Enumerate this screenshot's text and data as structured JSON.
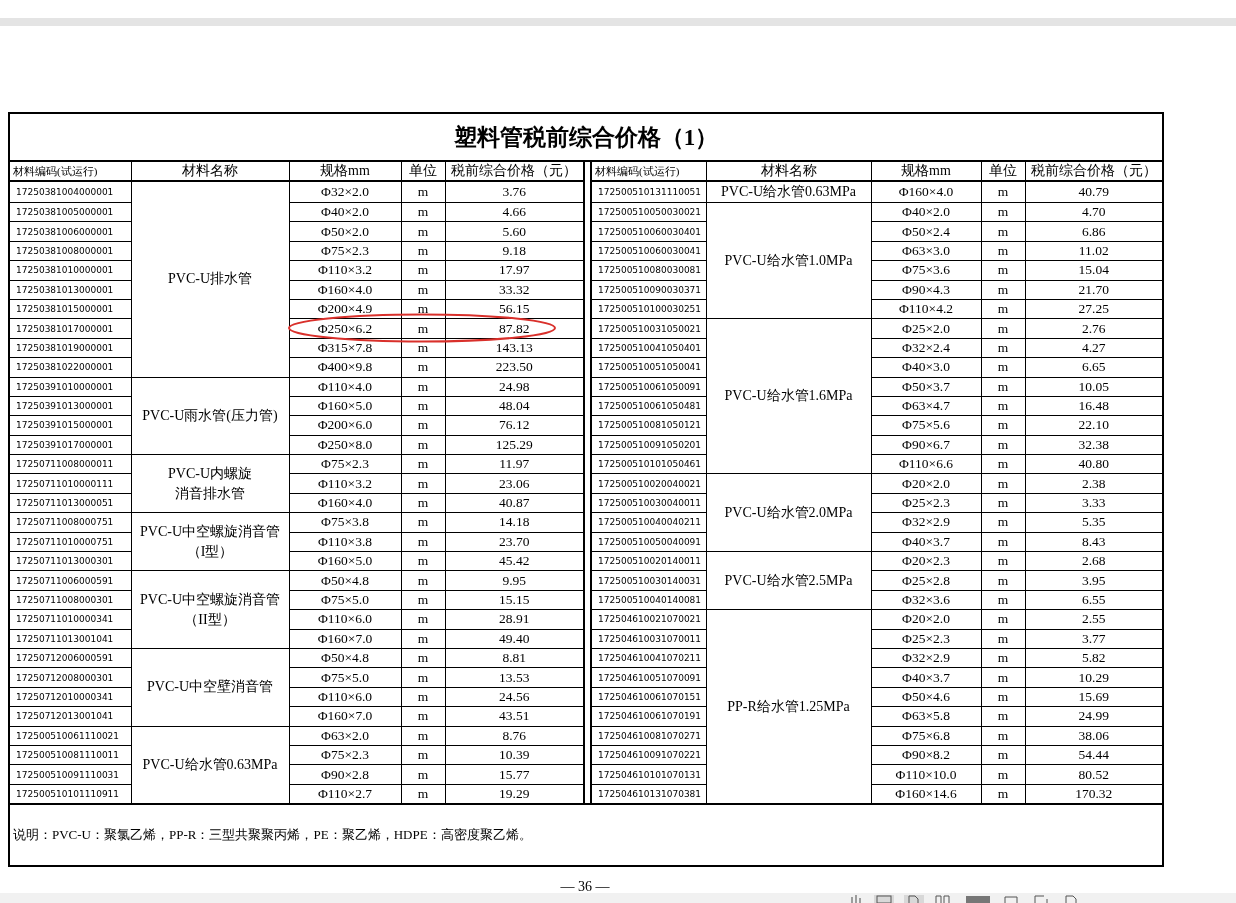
{
  "title": "塑料管税前综合价格（1）",
  "left": {
    "columns": [
      "材料编码(试运行)",
      "材料名称",
      "规格mm",
      "单位",
      "税前综合价格（元）"
    ],
    "groups": [
      {
        "name_lines": [
          "PVC-U排水管"
        ],
        "rows": [
          {
            "code": "17250381004000001",
            "spec": "Φ32×2.0",
            "unit": "m",
            "price": "3.76",
            "circled": false
          },
          {
            "code": "17250381005000001",
            "spec": "Φ40×2.0",
            "unit": "m",
            "price": "4.66",
            "circled": false
          },
          {
            "code": "17250381006000001",
            "spec": "Φ50×2.0",
            "unit": "m",
            "price": "5.60",
            "circled": false
          },
          {
            "code": "17250381008000001",
            "spec": "Φ75×2.3",
            "unit": "m",
            "price": "9.18",
            "circled": false
          },
          {
            "code": "17250381010000001",
            "spec": "Φ110×3.2",
            "unit": "m",
            "price": "17.97",
            "circled": false
          },
          {
            "code": "17250381013000001",
            "spec": "Φ160×4.0",
            "unit": "m",
            "price": "33.32",
            "circled": false
          },
          {
            "code": "17250381015000001",
            "spec": "Φ200×4.9",
            "unit": "m",
            "price": "56.15",
            "circled": false
          },
          {
            "code": "17250381017000001",
            "spec": "Φ250×6.2",
            "unit": "m",
            "price": "87.82",
            "circled": true
          },
          {
            "code": "17250381019000001",
            "spec": "Φ315×7.8",
            "unit": "m",
            "price": "143.13",
            "circled": false
          },
          {
            "code": "17250381022000001",
            "spec": "Φ400×9.8",
            "unit": "m",
            "price": "223.50",
            "circled": false
          }
        ]
      },
      {
        "name_lines": [
          "PVC-U雨水管(压力管)"
        ],
        "rows": [
          {
            "code": "17250391010000001",
            "spec": "Φ110×4.0",
            "unit": "m",
            "price": "24.98",
            "circled": false
          },
          {
            "code": "17250391013000001",
            "spec": "Φ160×5.0",
            "unit": "m",
            "price": "48.04",
            "circled": false
          },
          {
            "code": "17250391015000001",
            "spec": "Φ200×6.0",
            "unit": "m",
            "price": "76.12",
            "circled": false
          },
          {
            "code": "17250391017000001",
            "spec": "Φ250×8.0",
            "unit": "m",
            "price": "125.29",
            "circled": false
          }
        ]
      },
      {
        "name_lines": [
          "PVC-U内螺旋",
          "消音排水管"
        ],
        "rows": [
          {
            "code": "17250711008000011",
            "spec": "Φ75×2.3",
            "unit": "m",
            "price": "11.97",
            "circled": false
          },
          {
            "code": "17250711010000111",
            "spec": "Φ110×3.2",
            "unit": "m",
            "price": "23.06",
            "circled": false
          },
          {
            "code": "17250711013000051",
            "spec": "Φ160×4.0",
            "unit": "m",
            "price": "40.87",
            "circled": false
          }
        ]
      },
      {
        "name_lines": [
          "PVC-U中空螺旋消音管",
          "（I型）"
        ],
        "rows": [
          {
            "code": "17250711008000751",
            "spec": "Φ75×3.8",
            "unit": "m",
            "price": "14.18",
            "circled": false
          },
          {
            "code": "17250711010000751",
            "spec": "Φ110×3.8",
            "unit": "m",
            "price": "23.70",
            "circled": false
          },
          {
            "code": "17250711013000301",
            "spec": "Φ160×5.0",
            "unit": "m",
            "price": "45.42",
            "circled": false
          }
        ]
      },
      {
        "name_lines": [
          "PVC-U中空螺旋消音管",
          "（II型）"
        ],
        "rows": [
          {
            "code": "17250711006000591",
            "spec": "Φ50×4.8",
            "unit": "m",
            "price": "9.95",
            "circled": false
          },
          {
            "code": "17250711008000301",
            "spec": "Φ75×5.0",
            "unit": "m",
            "price": "15.15",
            "circled": false
          },
          {
            "code": "17250711010000341",
            "spec": "Φ110×6.0",
            "unit": "m",
            "price": "28.91",
            "circled": false
          },
          {
            "code": "17250711013001041",
            "spec": "Φ160×7.0",
            "unit": "m",
            "price": "49.40",
            "circled": false
          }
        ]
      },
      {
        "name_lines": [
          "PVC-U中空壁消音管"
        ],
        "rows": [
          {
            "code": "17250712006000591",
            "spec": "Φ50×4.8",
            "unit": "m",
            "price": "8.81",
            "circled": false
          },
          {
            "code": "17250712008000301",
            "spec": "Φ75×5.0",
            "unit": "m",
            "price": "13.53",
            "circled": false
          },
          {
            "code": "17250712010000341",
            "spec": "Φ110×6.0",
            "unit": "m",
            "price": "24.56",
            "circled": false
          },
          {
            "code": "17250712013001041",
            "spec": "Φ160×7.0",
            "unit": "m",
            "price": "43.51",
            "circled": false
          }
        ]
      },
      {
        "name_lines": [
          "PVC-U给水管0.63MPa"
        ],
        "rows": [
          {
            "code": "172500510061110021",
            "spec": "Φ63×2.0",
            "unit": "m",
            "price": "8.76",
            "circled": false
          },
          {
            "code": "172500510081110011",
            "spec": "Φ75×2.3",
            "unit": "m",
            "price": "10.39",
            "circled": false
          },
          {
            "code": "172500510091110031",
            "spec": "Φ90×2.8",
            "unit": "m",
            "price": "15.77",
            "circled": false
          },
          {
            "code": "172500510101110911",
            "spec": "Φ110×2.7",
            "unit": "m",
            "price": "19.29",
            "circled": false
          }
        ]
      }
    ]
  },
  "right": {
    "columns": [
      "材料编码(试运行)",
      "材料名称",
      "规格mm",
      "单位",
      "税前综合价格（元）"
    ],
    "groups": [
      {
        "name_lines": [
          "PVC-U给水管0.63MPa"
        ],
        "rows": [
          {
            "code": "172500510131110051",
            "spec": "Φ160×4.0",
            "unit": "m",
            "price": "40.79",
            "circled": false
          }
        ]
      },
      {
        "name_lines": [
          "PVC-U给水管1.0MPa"
        ],
        "rows": [
          {
            "code": "172500510050030021",
            "spec": "Φ40×2.0",
            "unit": "m",
            "price": "4.70",
            "circled": false
          },
          {
            "code": "172500510060030401",
            "spec": "Φ50×2.4",
            "unit": "m",
            "price": "6.86",
            "circled": false
          },
          {
            "code": "172500510060030041",
            "spec": "Φ63×3.0",
            "unit": "m",
            "price": "11.02",
            "circled": false
          },
          {
            "code": "172500510080030081",
            "spec": "Φ75×3.6",
            "unit": "m",
            "price": "15.04",
            "circled": false
          },
          {
            "code": "172500510090030371",
            "spec": "Φ90×4.3",
            "unit": "m",
            "price": "21.70",
            "circled": false
          },
          {
            "code": "172500510100030251",
            "spec": "Φ110×4.2",
            "unit": "m",
            "price": "27.25",
            "circled": false
          }
        ]
      },
      {
        "name_lines": [
          "PVC-U给水管1.6MPa"
        ],
        "rows": [
          {
            "code": "172500510031050021",
            "spec": "Φ25×2.0",
            "unit": "m",
            "price": "2.76",
            "circled": false
          },
          {
            "code": "172500510041050401",
            "spec": "Φ32×2.4",
            "unit": "m",
            "price": "4.27",
            "circled": false
          },
          {
            "code": "172500510051050041",
            "spec": "Φ40×3.0",
            "unit": "m",
            "price": "6.65",
            "circled": false
          },
          {
            "code": "172500510061050091",
            "spec": "Φ50×3.7",
            "unit": "m",
            "price": "10.05",
            "circled": false
          },
          {
            "code": "172500510061050481",
            "spec": "Φ63×4.7",
            "unit": "m",
            "price": "16.48",
            "circled": false
          },
          {
            "code": "172500510081050121",
            "spec": "Φ75×5.6",
            "unit": "m",
            "price": "22.10",
            "circled": false
          },
          {
            "code": "172500510091050201",
            "spec": "Φ90×6.7",
            "unit": "m",
            "price": "32.38",
            "circled": false
          },
          {
            "code": "172500510101050461",
            "spec": "Φ110×6.6",
            "unit": "m",
            "price": "40.80",
            "circled": false
          }
        ]
      },
      {
        "name_lines": [
          "PVC-U给水管2.0MPa"
        ],
        "rows": [
          {
            "code": "172500510020040021",
            "spec": "Φ20×2.0",
            "unit": "m",
            "price": "2.38",
            "circled": false
          },
          {
            "code": "172500510030040011",
            "spec": "Φ25×2.3",
            "unit": "m",
            "price": "3.33",
            "circled": false
          },
          {
            "code": "172500510040040211",
            "spec": "Φ32×2.9",
            "unit": "m",
            "price": "5.35",
            "circled": false
          },
          {
            "code": "172500510050040091",
            "spec": "Φ40×3.7",
            "unit": "m",
            "price": "8.43",
            "circled": false
          }
        ]
      },
      {
        "name_lines": [
          "PVC-U给水管2.5MPa"
        ],
        "rows": [
          {
            "code": "172500510020140011",
            "spec": "Φ20×2.3",
            "unit": "m",
            "price": "2.68",
            "circled": false
          },
          {
            "code": "172500510030140031",
            "spec": "Φ25×2.8",
            "unit": "m",
            "price": "3.95",
            "circled": false
          },
          {
            "code": "172500510040140081",
            "spec": "Φ32×3.6",
            "unit": "m",
            "price": "6.55",
            "circled": false
          }
        ]
      },
      {
        "name_lines": [
          "PP-R给水管1.25MPa"
        ],
        "rows": [
          {
            "code": "172504610021070021",
            "spec": "Φ20×2.0",
            "unit": "m",
            "price": "2.55",
            "circled": false
          },
          {
            "code": "172504610031070011",
            "spec": "Φ25×2.3",
            "unit": "m",
            "price": "3.77",
            "circled": false
          },
          {
            "code": "172504610041070211",
            "spec": "Φ32×2.9",
            "unit": "m",
            "price": "5.82",
            "circled": false
          },
          {
            "code": "172504610051070091",
            "spec": "Φ40×3.7",
            "unit": "m",
            "price": "10.29",
            "circled": false
          },
          {
            "code": "172504610061070151",
            "spec": "Φ50×4.6",
            "unit": "m",
            "price": "15.69",
            "circled": false
          },
          {
            "code": "172504610061070191",
            "spec": "Φ63×5.8",
            "unit": "m",
            "price": "24.99",
            "circled": false
          },
          {
            "code": "172504610081070271",
            "spec": "Φ75×6.8",
            "unit": "m",
            "price": "38.06",
            "circled": false
          },
          {
            "code": "172504610091070221",
            "spec": "Φ90×8.2",
            "unit": "m",
            "price": "54.44",
            "circled": false
          },
          {
            "code": "172504610101070131",
            "spec": "Φ110×10.0",
            "unit": "m",
            "price": "80.52",
            "circled": false
          },
          {
            "code": "172504610131070381",
            "spec": "Φ160×14.6",
            "unit": "m",
            "price": "170.32",
            "circled": false
          }
        ]
      }
    ]
  },
  "note": "说明：PVC-U：聚氯乙烯，PP-R：三型共聚聚丙烯，PE：聚乙烯，HDPE：高密度聚乙烯。",
  "page_number": "— 36 —"
}
